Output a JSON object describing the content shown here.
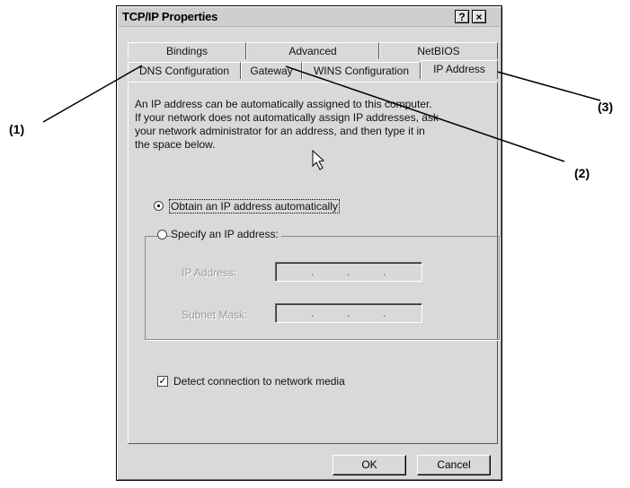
{
  "window": {
    "title": "TCP/IP Properties",
    "help_glyph": "?",
    "close_glyph": "×"
  },
  "tabs_back": [
    "Bindings",
    "Advanced",
    "NetBIOS"
  ],
  "tabs_front": [
    "DNS Configuration",
    "Gateway",
    "WINS Configuration",
    "IP Address"
  ],
  "active_tab": "IP Address",
  "description": [
    "An IP address can be automatically assigned to this computer.",
    "If your network does not automatically assign IP addresses, ask",
    "your network administrator for an address, and then type it in",
    "the space below."
  ],
  "options": {
    "obtain_label": "Obtain an IP address automatically",
    "obtain_selected": true,
    "specify_label": "Specify an IP address:",
    "specify_selected": false
  },
  "fields": {
    "ip_label": "IP Address:",
    "subnet_label": "Subnet Mask:",
    "dot": "."
  },
  "detect": {
    "label": "Detect connection to network media",
    "checked": true,
    "check_glyph": "✓"
  },
  "buttons": {
    "ok": "OK",
    "cancel": "Cancel"
  },
  "callouts": [
    "(1)",
    "(2)",
    "(3)"
  ],
  "icons": [
    "help-icon",
    "close-icon",
    "mouse-pointer-icon",
    "radio-icon",
    "checkbox-icon"
  ]
}
